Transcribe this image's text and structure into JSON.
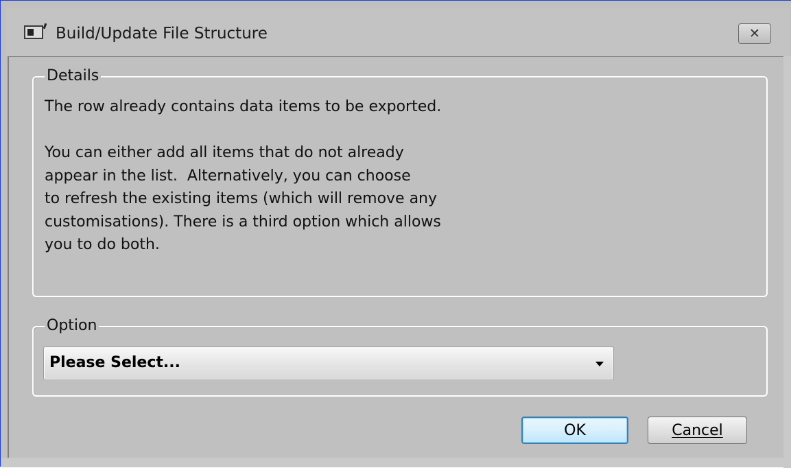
{
  "window": {
    "title": "Build/Update File Structure",
    "close_glyph": "✕",
    "border_color": "#1d3fd8"
  },
  "details": {
    "legend": "Details",
    "lines": [
      "The row already contains data items to be exported.",
      "",
      "You can either add all items that do not already",
      "appear in the list.  Alternatively, you can choose",
      "to refresh the existing items (which will remove any",
      "customisations). There is a third option which allows",
      "you to do both."
    ]
  },
  "option": {
    "legend": "Option",
    "selected_value": "Please Select..."
  },
  "buttons": {
    "ok_label": "OK",
    "cancel_label": "Cancel",
    "ok_accent": "#3c7fb1"
  },
  "icons": {
    "app": "window-app-icon",
    "close": "close-icon",
    "dropdown": "chevron-down-icon"
  }
}
